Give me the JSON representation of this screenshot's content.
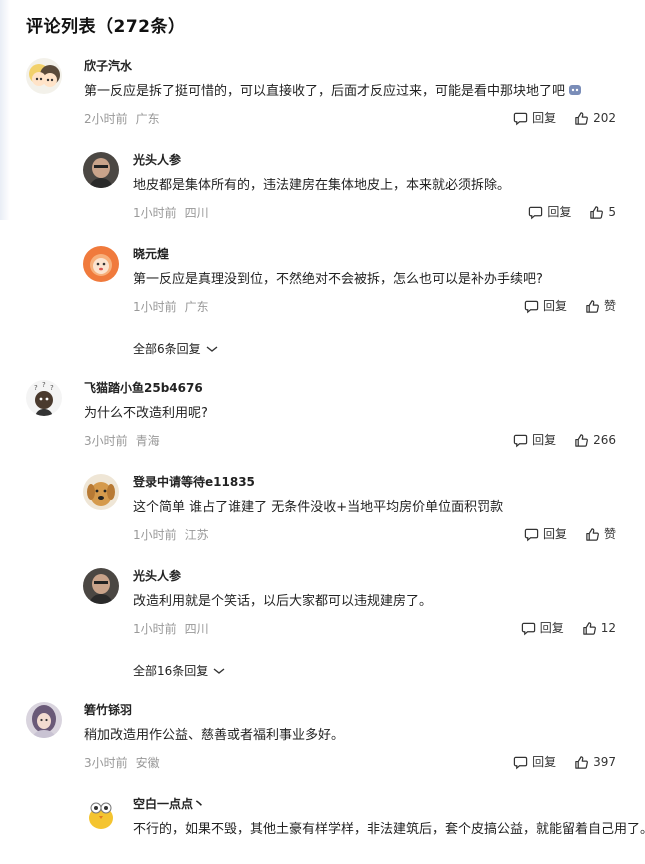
{
  "title": "评论列表（272条）",
  "comments": [
    {
      "user": "欣子汽水",
      "text": "第一反应是拆了挺可惜的，可以直接收了，后面才反应过来，可能是看中那块地了吧",
      "time": "2小时前",
      "location": "广东",
      "reply_label": "回复",
      "likes": "202",
      "replies": [
        {
          "user": "光头人参",
          "text": "地皮都是集体所有的，违法建房在集体地皮上，本来就必须拆除。",
          "time": "1小时前",
          "location": "四川",
          "reply_label": "回复",
          "likes": "5"
        },
        {
          "user": "晓元煌",
          "text": "第一反应是真理没到位，不然绝对不会被拆，怎么也可以是补办手续吧?",
          "time": "1小时前",
          "location": "广东",
          "reply_label": "回复",
          "likes": "赞"
        }
      ],
      "more_replies": "全部6条回复"
    },
    {
      "user": "飞猫踏小鱼25b4676",
      "text": "为什么不改造利用呢?",
      "time": "3小时前",
      "location": "青海",
      "reply_label": "回复",
      "likes": "266",
      "replies": [
        {
          "user": "登录中请等待e11835",
          "text": "这个简单 谁占了谁建了 无条件没收+当地平均房价单位面积罚款",
          "time": "1小时前",
          "location": "江苏",
          "reply_label": "回复",
          "likes": "赞"
        },
        {
          "user": "光头人参",
          "text": "改造利用就是个笑话，以后大家都可以违规建房了。",
          "time": "1小时前",
          "location": "四川",
          "reply_label": "回复",
          "likes": "12"
        }
      ],
      "more_replies": "全部16条回复"
    },
    {
      "user": "箬竹铩羽",
      "text": "稍加改造用作公益、慈善或者福利事业多好。",
      "time": "3小时前",
      "location": "安徽",
      "reply_label": "回复",
      "likes": "397",
      "replies": [
        {
          "user": "空白一点点丶",
          "text": "不行的，如果不毁，其他土豪有样学样，非法建筑后，套个皮搞公益，就能留着自己用了。"
        }
      ]
    }
  ],
  "icons": {
    "reply": "comment-bubble-icon",
    "like": "thumbs-up-icon",
    "expand": "chevron-down-icon"
  },
  "colors": {
    "text": "#222222",
    "meta": "#999999",
    "background": "#ffffff"
  }
}
